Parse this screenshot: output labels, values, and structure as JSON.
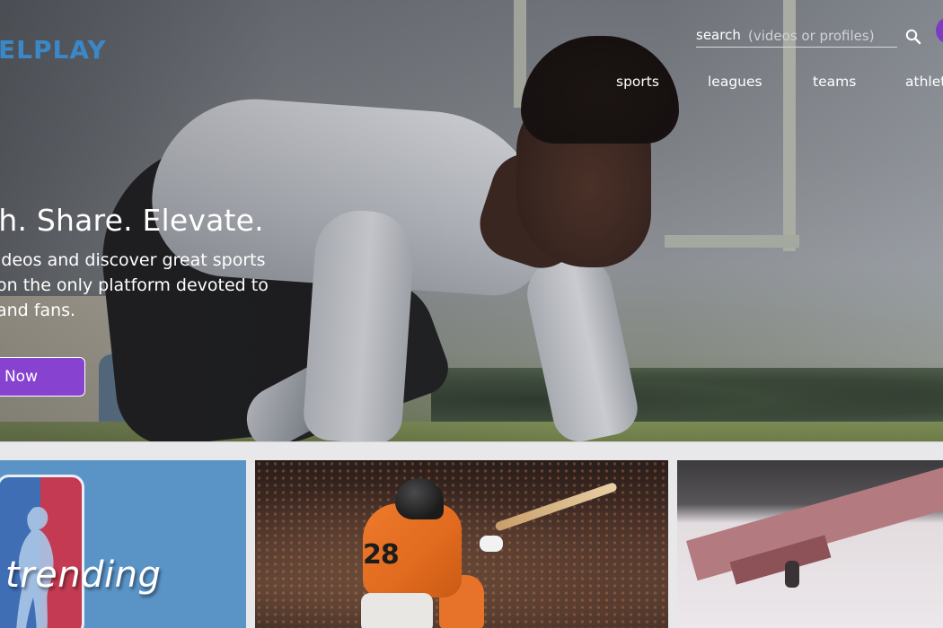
{
  "brand": {
    "logo_text": "ELPLAY",
    "logo_color": "#3b88c9",
    "accent_color": "#8743d0"
  },
  "search": {
    "label": "search",
    "placeholder": "(videos or profiles)",
    "icon": "search-icon"
  },
  "nav": {
    "items": [
      {
        "label": "sports"
      },
      {
        "label": "leagues"
      },
      {
        "label": "teams"
      },
      {
        "label": "athlet"
      }
    ]
  },
  "hero": {
    "title": "ch. Share. Elevate.",
    "description_lines": [
      "ideos and discover great sports",
      "on the only platform devoted to",
      "and fans."
    ],
    "cta_label": "Now"
  },
  "cards": [
    {
      "label": "trending",
      "icon": "nba-logo-icon"
    },
    {
      "label": "",
      "icon": "baseball-batter-image"
    },
    {
      "label": "",
      "icon": "skiing-image"
    }
  ]
}
